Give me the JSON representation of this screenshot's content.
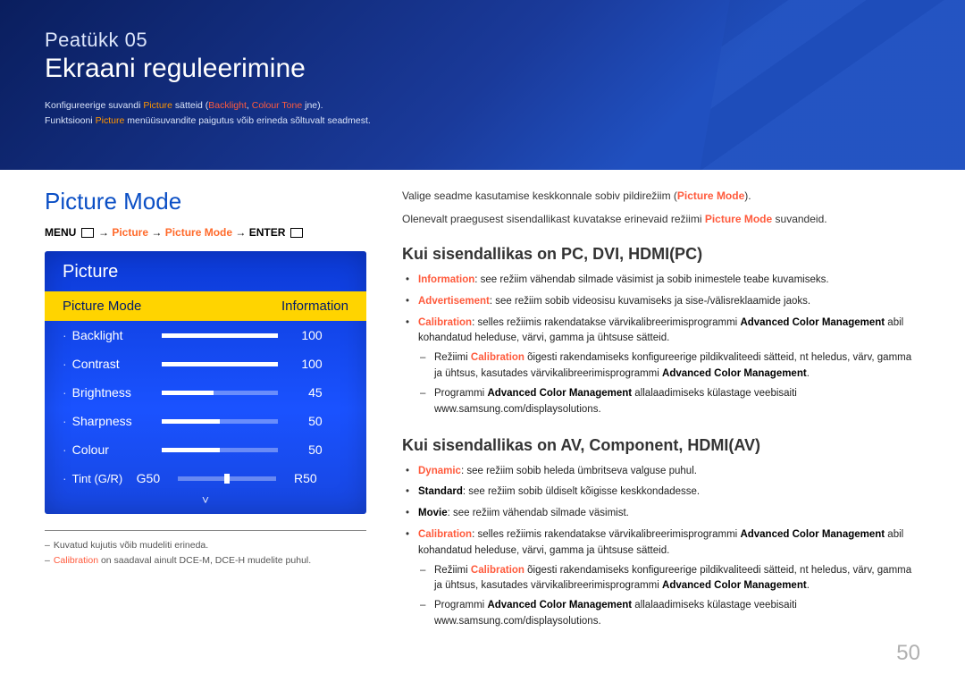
{
  "banner": {
    "chapter": "Peatükk 05",
    "title": "Ekraani reguleerimine",
    "line1_pre": "Konfigureerige suvandi ",
    "line1_picture": "Picture",
    "line1_mid": " sätteid (",
    "line1_backlight": "Backlight",
    "line1_sep": ", ",
    "line1_tone": "Colour Tone",
    "line1_after": " jne).",
    "line2_pre": "Funktsiooni ",
    "line2_picture": "Picture",
    "line2_after": " menüüsuvandite paigutus võib erineda sõltuvalt seadmest."
  },
  "left": {
    "section_title": "Picture Mode",
    "path_menu": "MENU ",
    "path_arrow": " → ",
    "path_picture": "Picture",
    "path_mode": "Picture Mode",
    "path_enter": "ENTER ",
    "menu_icon1": "⌗",
    "menu_icon2": "↵",
    "osd": {
      "title": "Picture",
      "selected_label": "Picture Mode",
      "selected_value": "Information",
      "rows": [
        {
          "label": "Backlight",
          "value": "100",
          "fill": 100
        },
        {
          "label": "Contrast",
          "value": "100",
          "fill": 100
        },
        {
          "label": "Brightness",
          "value": "45",
          "fill": 45
        },
        {
          "label": "Sharpness",
          "value": "50",
          "fill": 50
        },
        {
          "label": "Colour",
          "value": "50",
          "fill": 50
        }
      ],
      "tint_label": "Tint (G/R)",
      "tint_g": "G50",
      "tint_r": "R50",
      "chevron": "˅"
    },
    "foot1": "Kuvatud kujutis võib mudeliti erineda.",
    "foot2_cal": "Calibration",
    "foot2_rest": " on saadaval ainult DCE-M, DCE-H mudelite puhul."
  },
  "right": {
    "lead1_pre": "Valige seadme kasutamise keskkonnale sobiv pildirežiim (",
    "lead1_pm": "Picture Mode",
    "lead1_post": ").",
    "lead2_pre": "Olenevalt praegusest sisendallikast kuvatakse erinevaid režiimi ",
    "lead2_pm": "Picture Mode",
    "lead2_post": " suvandeid.",
    "h1": "Kui sisendallikas on PC, DVI, HDMI(PC)",
    "pc_items": {
      "info_kw": "Information",
      "info_txt": ": see režiim vähendab silmade väsimist ja sobib inimestele teabe kuvamiseks.",
      "adv_kw": "Advertisement",
      "adv_txt": ": see režiim sobib videosisu kuvamiseks ja sise-/välisreklaamide jaoks.",
      "cal_kw": "Calibration",
      "cal_txt_a": ": selles režiimis rakendatakse värvikalibreerimisprogrammi ",
      "cal_acm": "Advanced Color Management",
      "cal_txt_b": " abil kohandatud heleduse, värvi, gamma ja ühtsuse sätteid.",
      "sub1_a": "Režiimi ",
      "sub1_cal": "Calibration",
      "sub1_b": " õigesti rakendamiseks konfigureerige pildikvaliteedi sätteid, nt heledus, värv, gamma ja ühtsus, kasutades värvikalibreerimisprogrammi ",
      "sub1_acm": "Advanced Color Management",
      "sub1_c": ".",
      "sub2_a": "Programmi ",
      "sub2_acm": "Advanced Color Management",
      "sub2_b": " allalaadimiseks külastage veebisaiti www.samsung.com/displaysolutions."
    },
    "h2": "Kui sisendallikas on AV, Component, HDMI(AV)",
    "av_items": {
      "dyn_kw": "Dynamic",
      "dyn_txt": ": see režiim sobib heleda ümbritseva valguse puhul.",
      "std_kw": "Standard",
      "std_txt": ": see režiim sobib üldiselt kõigisse keskkondadesse.",
      "mov_kw": "Movie",
      "mov_txt": ": see režiim vähendab silmade väsimist.",
      "cal_kw": "Calibration",
      "cal_txt_a": ": selles režiimis rakendatakse värvikalibreerimisprogrammi ",
      "cal_acm": "Advanced Color Management",
      "cal_txt_b": " abil kohandatud heleduse, värvi, gamma ja ühtsuse sätteid.",
      "sub1_a": "Režiimi ",
      "sub1_cal": "Calibration",
      "sub1_b": " õigesti rakendamiseks konfigureerige pildikvaliteedi sätteid, nt heledus, värv, gamma ja ühtsus, kasutades värvikalibreerimisprogrammi ",
      "sub1_acm": "Advanced Color Management",
      "sub1_c": ".",
      "sub2_a": "Programmi ",
      "sub2_acm": "Advanced Color Management",
      "sub2_b": " allalaadimiseks külastage veebisaiti www.samsung.com/displaysolutions."
    }
  },
  "page_number": "50"
}
